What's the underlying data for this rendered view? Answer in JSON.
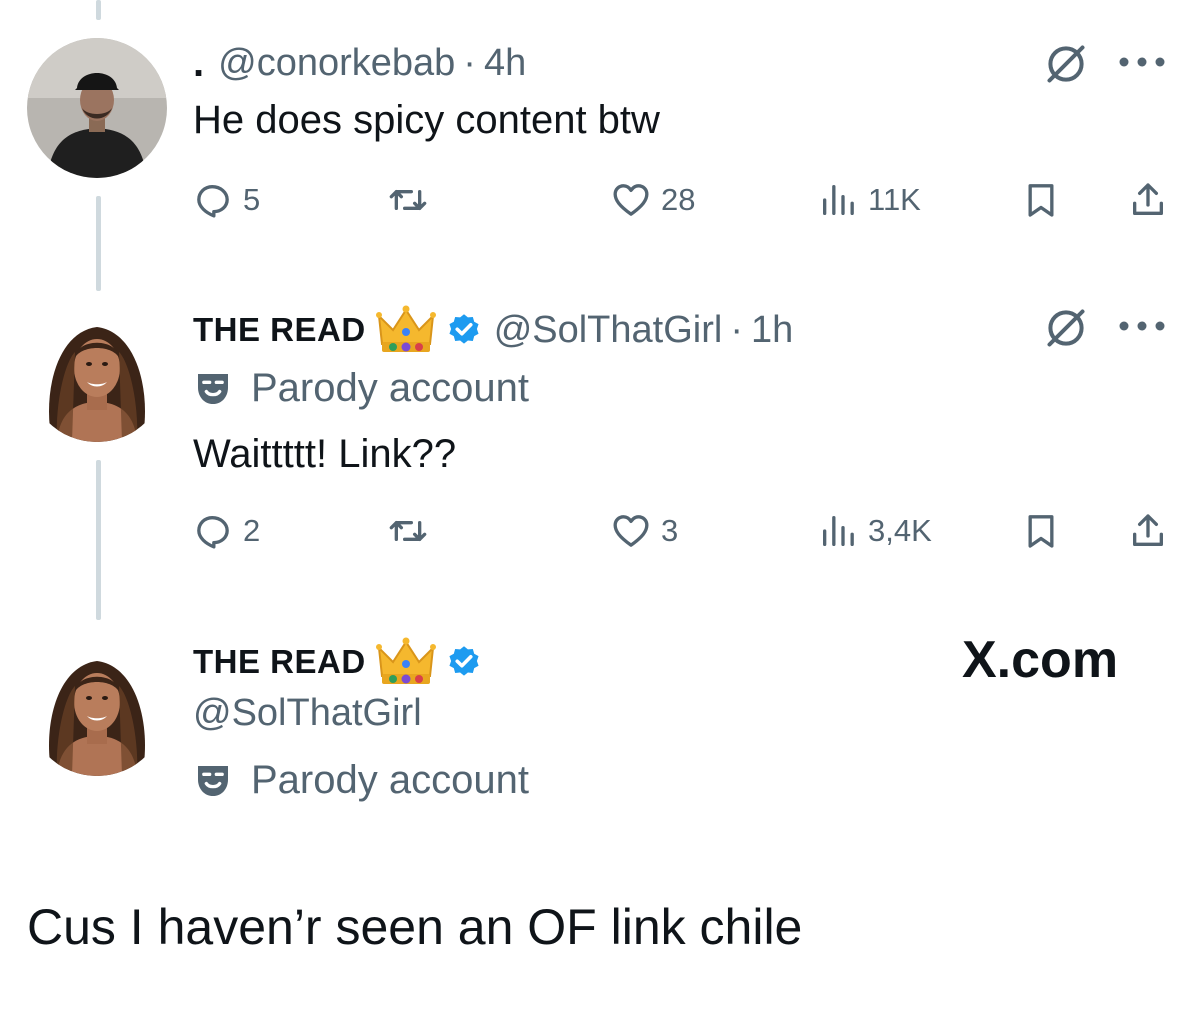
{
  "tweet1": {
    "prefix": ".",
    "handle": "@conorkebab",
    "separator": "·",
    "time": "4h",
    "text": "He does spicy content btw",
    "replies": "5",
    "likes": "28",
    "views": "11K"
  },
  "tweet2": {
    "display_name": "THE READ",
    "handle": "@SolThatGirl",
    "separator": "·",
    "time": "1h",
    "label": "Parody account",
    "text": "Waittttt! Link??",
    "replies": "2",
    "likes": "3",
    "views": "3,4K"
  },
  "profile": {
    "display_name": "THE READ",
    "handle": "@SolThatGirl",
    "label": "Parody account"
  },
  "watermark": "X.com",
  "caption": "Cus I haven’r seen an OF link chile",
  "colors": {
    "text": "#0f1419",
    "muted": "#536471",
    "verified": "#1d9bf0",
    "thread_line": "#cfd9de"
  },
  "icons": [
    "reply-icon",
    "retweet-icon",
    "like-icon",
    "views-icon",
    "bookmark-icon",
    "share-icon",
    "grok-icon",
    "more-icon",
    "verified-icon",
    "crown-emoji",
    "parody-mask-icon"
  ]
}
